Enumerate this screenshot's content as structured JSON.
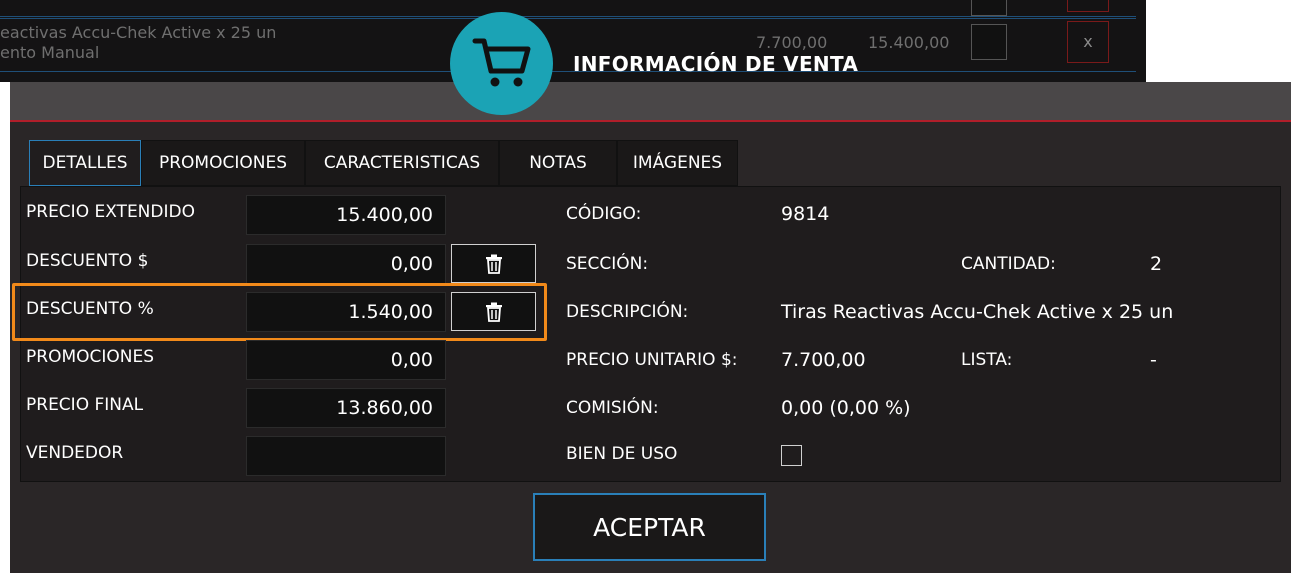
{
  "background_list": {
    "row1_text": "",
    "row2_line1": "eactivas Accu-Chek Active x 25 un",
    "row2_line2": "ento Manual",
    "row2_price": "7.700,00",
    "row2_total": "15.400,00",
    "row2_remove": "x"
  },
  "modal": {
    "title": "INFORMACIÓN DE VENTA",
    "icon": "shopping-cart-icon",
    "accent_color": "#1ba3b5"
  },
  "tabs": [
    {
      "label": "DETALLES",
      "active": true
    },
    {
      "label": "PROMOCIONES",
      "active": false
    },
    {
      "label": "CARACTERISTICAS",
      "active": false
    },
    {
      "label": "NOTAS",
      "active": false
    },
    {
      "label": "IMÁGENES",
      "active": false
    }
  ],
  "details": {
    "precio_extendido": {
      "label": "PRECIO EXTENDIDO",
      "value": "15.400,00"
    },
    "descuento_monto": {
      "label": "DESCUENTO $",
      "value": "0,00"
    },
    "descuento_pct": {
      "label": "DESCUENTO %",
      "value": "1.540,00"
    },
    "promociones": {
      "label": "PROMOCIONES",
      "value": "0,00"
    },
    "precio_final": {
      "label": "PRECIO FINAL",
      "value": "13.860,00"
    },
    "vendedor": {
      "label": "VENDEDOR",
      "value": ""
    }
  },
  "info": {
    "codigo": {
      "label": "CÓDIGO:",
      "value": "9814"
    },
    "seccion": {
      "label": "SECCIÓN:",
      "value": ""
    },
    "cantidad": {
      "label": "CANTIDAD:",
      "value": "2"
    },
    "descripcion": {
      "label": "DESCRIPCIÓN:",
      "value": "Tiras Reactivas Accu-Chek Active x 25 un"
    },
    "precio_unitario": {
      "label": "PRECIO UNITARIO $:",
      "value": "7.700,00"
    },
    "lista": {
      "label": "LISTA:",
      "value": "-"
    },
    "comision": {
      "label": "COMISIÓN:",
      "value": "0,00 (0,00 %)"
    },
    "bien_de_uso": {
      "label": "BIEN DE USO",
      "checked": false
    }
  },
  "actions": {
    "accept_label": "ACEPTAR"
  },
  "colors": {
    "highlight": "#f28a1a",
    "header_rule": "#b01e2a",
    "tab_active_border": "#2a7fb8"
  }
}
